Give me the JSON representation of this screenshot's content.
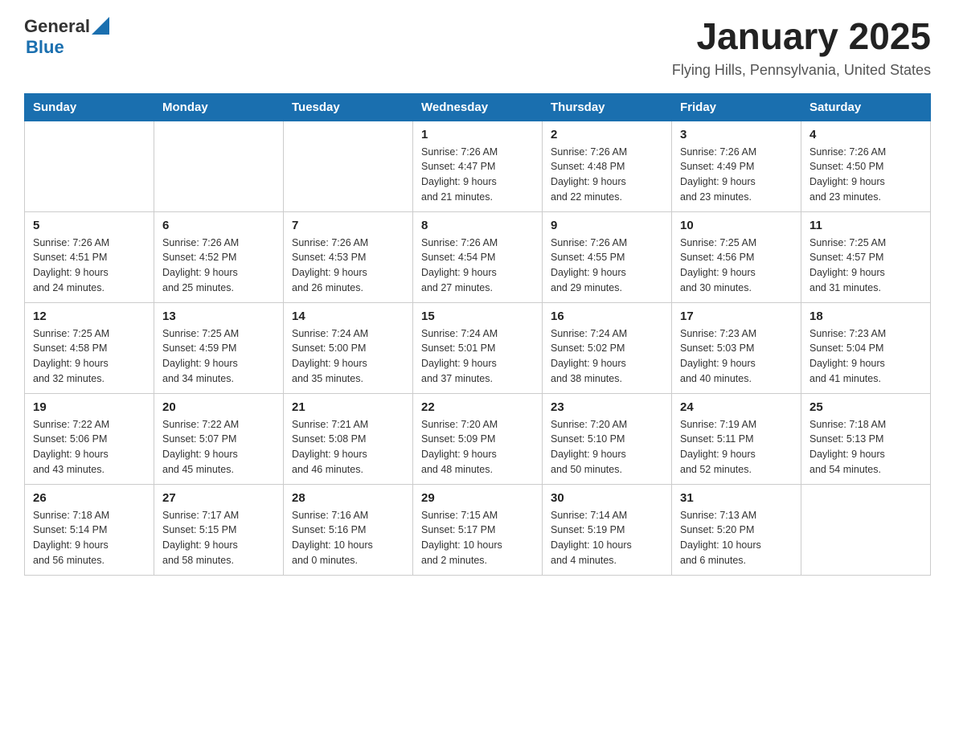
{
  "header": {
    "logo_general": "General",
    "logo_blue": "Blue",
    "title": "January 2025",
    "subtitle": "Flying Hills, Pennsylvania, United States"
  },
  "calendar": {
    "days_of_week": [
      "Sunday",
      "Monday",
      "Tuesday",
      "Wednesday",
      "Thursday",
      "Friday",
      "Saturday"
    ],
    "weeks": [
      {
        "days": [
          {
            "number": "",
            "info": ""
          },
          {
            "number": "",
            "info": ""
          },
          {
            "number": "",
            "info": ""
          },
          {
            "number": "1",
            "info": "Sunrise: 7:26 AM\nSunset: 4:47 PM\nDaylight: 9 hours\nand 21 minutes."
          },
          {
            "number": "2",
            "info": "Sunrise: 7:26 AM\nSunset: 4:48 PM\nDaylight: 9 hours\nand 22 minutes."
          },
          {
            "number": "3",
            "info": "Sunrise: 7:26 AM\nSunset: 4:49 PM\nDaylight: 9 hours\nand 23 minutes."
          },
          {
            "number": "4",
            "info": "Sunrise: 7:26 AM\nSunset: 4:50 PM\nDaylight: 9 hours\nand 23 minutes."
          }
        ]
      },
      {
        "days": [
          {
            "number": "5",
            "info": "Sunrise: 7:26 AM\nSunset: 4:51 PM\nDaylight: 9 hours\nand 24 minutes."
          },
          {
            "number": "6",
            "info": "Sunrise: 7:26 AM\nSunset: 4:52 PM\nDaylight: 9 hours\nand 25 minutes."
          },
          {
            "number": "7",
            "info": "Sunrise: 7:26 AM\nSunset: 4:53 PM\nDaylight: 9 hours\nand 26 minutes."
          },
          {
            "number": "8",
            "info": "Sunrise: 7:26 AM\nSunset: 4:54 PM\nDaylight: 9 hours\nand 27 minutes."
          },
          {
            "number": "9",
            "info": "Sunrise: 7:26 AM\nSunset: 4:55 PM\nDaylight: 9 hours\nand 29 minutes."
          },
          {
            "number": "10",
            "info": "Sunrise: 7:25 AM\nSunset: 4:56 PM\nDaylight: 9 hours\nand 30 minutes."
          },
          {
            "number": "11",
            "info": "Sunrise: 7:25 AM\nSunset: 4:57 PM\nDaylight: 9 hours\nand 31 minutes."
          }
        ]
      },
      {
        "days": [
          {
            "number": "12",
            "info": "Sunrise: 7:25 AM\nSunset: 4:58 PM\nDaylight: 9 hours\nand 32 minutes."
          },
          {
            "number": "13",
            "info": "Sunrise: 7:25 AM\nSunset: 4:59 PM\nDaylight: 9 hours\nand 34 minutes."
          },
          {
            "number": "14",
            "info": "Sunrise: 7:24 AM\nSunset: 5:00 PM\nDaylight: 9 hours\nand 35 minutes."
          },
          {
            "number": "15",
            "info": "Sunrise: 7:24 AM\nSunset: 5:01 PM\nDaylight: 9 hours\nand 37 minutes."
          },
          {
            "number": "16",
            "info": "Sunrise: 7:24 AM\nSunset: 5:02 PM\nDaylight: 9 hours\nand 38 minutes."
          },
          {
            "number": "17",
            "info": "Sunrise: 7:23 AM\nSunset: 5:03 PM\nDaylight: 9 hours\nand 40 minutes."
          },
          {
            "number": "18",
            "info": "Sunrise: 7:23 AM\nSunset: 5:04 PM\nDaylight: 9 hours\nand 41 minutes."
          }
        ]
      },
      {
        "days": [
          {
            "number": "19",
            "info": "Sunrise: 7:22 AM\nSunset: 5:06 PM\nDaylight: 9 hours\nand 43 minutes."
          },
          {
            "number": "20",
            "info": "Sunrise: 7:22 AM\nSunset: 5:07 PM\nDaylight: 9 hours\nand 45 minutes."
          },
          {
            "number": "21",
            "info": "Sunrise: 7:21 AM\nSunset: 5:08 PM\nDaylight: 9 hours\nand 46 minutes."
          },
          {
            "number": "22",
            "info": "Sunrise: 7:20 AM\nSunset: 5:09 PM\nDaylight: 9 hours\nand 48 minutes."
          },
          {
            "number": "23",
            "info": "Sunrise: 7:20 AM\nSunset: 5:10 PM\nDaylight: 9 hours\nand 50 minutes."
          },
          {
            "number": "24",
            "info": "Sunrise: 7:19 AM\nSunset: 5:11 PM\nDaylight: 9 hours\nand 52 minutes."
          },
          {
            "number": "25",
            "info": "Sunrise: 7:18 AM\nSunset: 5:13 PM\nDaylight: 9 hours\nand 54 minutes."
          }
        ]
      },
      {
        "days": [
          {
            "number": "26",
            "info": "Sunrise: 7:18 AM\nSunset: 5:14 PM\nDaylight: 9 hours\nand 56 minutes."
          },
          {
            "number": "27",
            "info": "Sunrise: 7:17 AM\nSunset: 5:15 PM\nDaylight: 9 hours\nand 58 minutes."
          },
          {
            "number": "28",
            "info": "Sunrise: 7:16 AM\nSunset: 5:16 PM\nDaylight: 10 hours\nand 0 minutes."
          },
          {
            "number": "29",
            "info": "Sunrise: 7:15 AM\nSunset: 5:17 PM\nDaylight: 10 hours\nand 2 minutes."
          },
          {
            "number": "30",
            "info": "Sunrise: 7:14 AM\nSunset: 5:19 PM\nDaylight: 10 hours\nand 4 minutes."
          },
          {
            "number": "31",
            "info": "Sunrise: 7:13 AM\nSunset: 5:20 PM\nDaylight: 10 hours\nand 6 minutes."
          },
          {
            "number": "",
            "info": ""
          }
        ]
      }
    ]
  }
}
